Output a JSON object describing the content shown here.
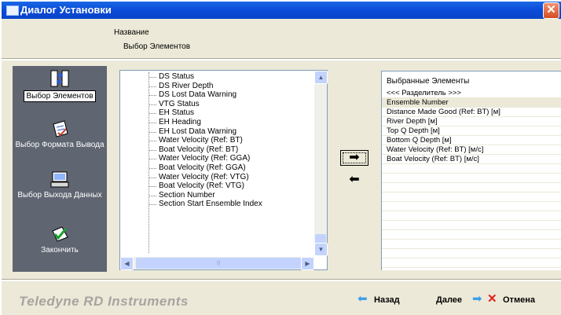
{
  "window": {
    "title": "Диалог Установки",
    "close": "✕"
  },
  "header": {
    "title": "Название",
    "subtitle": "Выбор Элементов"
  },
  "sidebar": {
    "items": [
      {
        "label": "Выбор Элементов",
        "icon": "element-selection-icon",
        "active": true
      },
      {
        "label": "Выбор Формата Вывода",
        "icon": "output-format-icon"
      },
      {
        "label": "Выбор Выхода Данных",
        "icon": "data-output-icon"
      },
      {
        "label": "Закончить",
        "icon": "finish-icon"
      }
    ]
  },
  "available": {
    "items": [
      "DS Status",
      "DS River Depth",
      "DS Lost Data Warning",
      "VTG Status",
      "EH Status",
      "EH Heading",
      "EH Lost Data Warning",
      "Water Velocity (Ref: BT)",
      "Boat Velocity (Ref: BT)",
      "Water Velocity (Ref: GGA)",
      "Boat Velocity (Ref: GGA)",
      "Water Velocity (Ref: VTG)",
      "Boat Velocity (Ref: VTG)",
      "Section Number",
      "Section Start Ensemble Index"
    ]
  },
  "transfer": {
    "add_glyph": "➡",
    "remove_glyph": "⬅"
  },
  "selected": {
    "header": "Выбранные Элементы",
    "items": [
      "<<< Разделитель >>>",
      "Ensemble Number",
      "Distance Made Good (Ref: BT) [м]",
      "River Depth [м]",
      "Top Q Depth [м]",
      "Bottom Q Depth [м]",
      "Water Velocity (Ref: BT) [м/с]",
      "Boat Velocity (Ref: BT) [м/с]"
    ],
    "selected_index": 1
  },
  "footer": {
    "brand": "Teledyne RD Instruments",
    "back": "Назад",
    "next": "Далее",
    "cancel": "Отмена"
  },
  "colors": {
    "title_bar": "#0a49d6",
    "dialog_bg": "#ece9d8",
    "sidebar_bg": "#5f6571",
    "arrow_blue": "#3aa0e8",
    "cancel_red": "#e0201c"
  }
}
